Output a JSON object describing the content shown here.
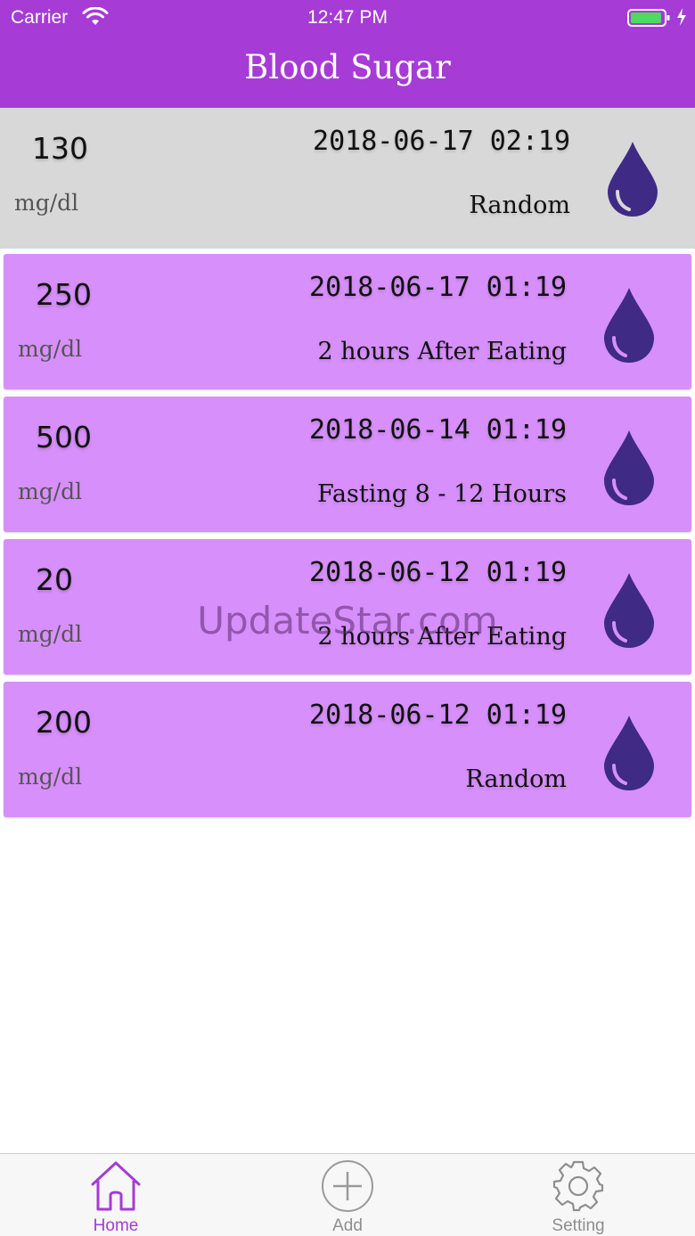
{
  "status_bar": {
    "carrier": "Carrier",
    "time": "12:47 PM",
    "battery_color": "#4cd964"
  },
  "header": {
    "title": "Blood Sugar",
    "background": "#a63bd6"
  },
  "entries": [
    {
      "value": "130",
      "unit": "mg/dl",
      "datetime": "2018-06-17 02:19",
      "condition": "Random",
      "selected": true
    },
    {
      "value": "250",
      "unit": "mg/dl",
      "datetime": "2018-06-17 01:19",
      "condition": "2 hours After Eating",
      "selected": false
    },
    {
      "value": "500",
      "unit": "mg/dl",
      "datetime": "2018-06-14 01:19",
      "condition": "Fasting 8 - 12 Hours",
      "selected": false
    },
    {
      "value": "20",
      "unit": "mg/dl",
      "datetime": "2018-06-12 01:19",
      "condition": "2 hours After Eating",
      "selected": false
    },
    {
      "value": "200",
      "unit": "mg/dl",
      "datetime": "2018-06-12 01:19",
      "condition": "Random",
      "selected": false
    }
  ],
  "entry_icon": "blood-drop-icon",
  "card_color": "#d78ffb",
  "drop_color": "#3f2a86",
  "watermark": "UpdateStar.com",
  "tabs": [
    {
      "label": "Home",
      "icon": "home-icon",
      "active": true
    },
    {
      "label": "Add",
      "icon": "add-circle-icon",
      "active": false
    },
    {
      "label": "Setting",
      "icon": "gear-icon",
      "active": false
    }
  ]
}
